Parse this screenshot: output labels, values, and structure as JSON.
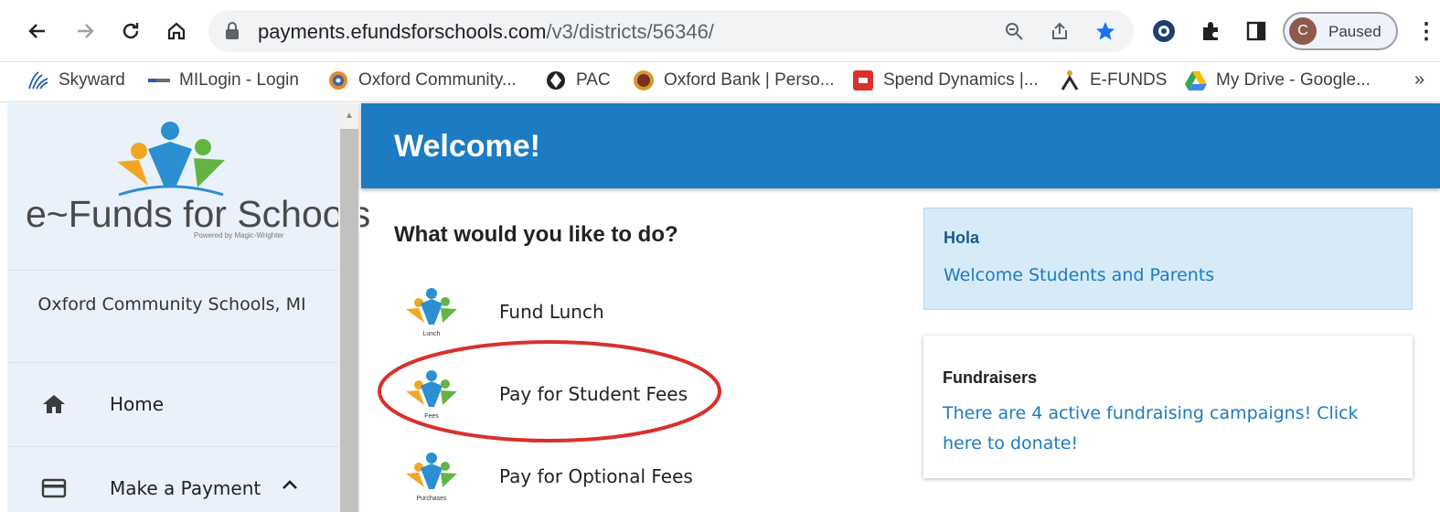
{
  "browser": {
    "url_domain": "payments.efundsforschools.com",
    "url_path": "/v3/districts/56346/",
    "profile_initial": "C",
    "profile_status": "Paused",
    "bookmarks": [
      {
        "label": "Skyward",
        "icon": "skyward-icon"
      },
      {
        "label": "MILogin - Login",
        "icon": "milogin-icon"
      },
      {
        "label": "Oxford Community...",
        "icon": "oxford-community-icon"
      },
      {
        "label": "PAC",
        "icon": "pac-icon"
      },
      {
        "label": "Oxford Bank | Perso...",
        "icon": "oxford-bank-icon"
      },
      {
        "label": "Spend Dynamics |...",
        "icon": "spend-dynamics-icon"
      },
      {
        "label": "E-FUNDS",
        "icon": "efunds-icon"
      },
      {
        "label": "My Drive - Google...",
        "icon": "google-drive-icon"
      }
    ],
    "bookmarks_overflow": "»"
  },
  "sidebar": {
    "logo_text": "e~Funds for Schools",
    "logo_tagline": "Powered by Magic-Wrighter",
    "school_name": "Oxford Community Schools, MI",
    "items": [
      {
        "label": "Home",
        "icon": "home-icon"
      },
      {
        "label": "Make a Payment",
        "icon": "credit-card-icon"
      }
    ]
  },
  "main": {
    "banner_title": "Welcome!",
    "question": "What would you like to do?",
    "actions": [
      {
        "label": "Fund Lunch",
        "icon_caption": "Lunch"
      },
      {
        "label": "Pay for Student Fees",
        "icon_caption": "Fees"
      },
      {
        "label": "Pay for Optional Fees",
        "icon_caption": "Purchases"
      }
    ],
    "hola_card": {
      "title": "Hola",
      "text": "Welcome Students and Parents"
    },
    "fundraisers_card": {
      "title": "Fundraisers",
      "text": "There are 4 active fundraising campaigns! Click here to donate!"
    }
  },
  "colors": {
    "banner": "#1c7bc2",
    "link": "#1c7bc2",
    "highlight_ring": "#d9302c",
    "sidebar_bg": "#e9f2fb"
  }
}
